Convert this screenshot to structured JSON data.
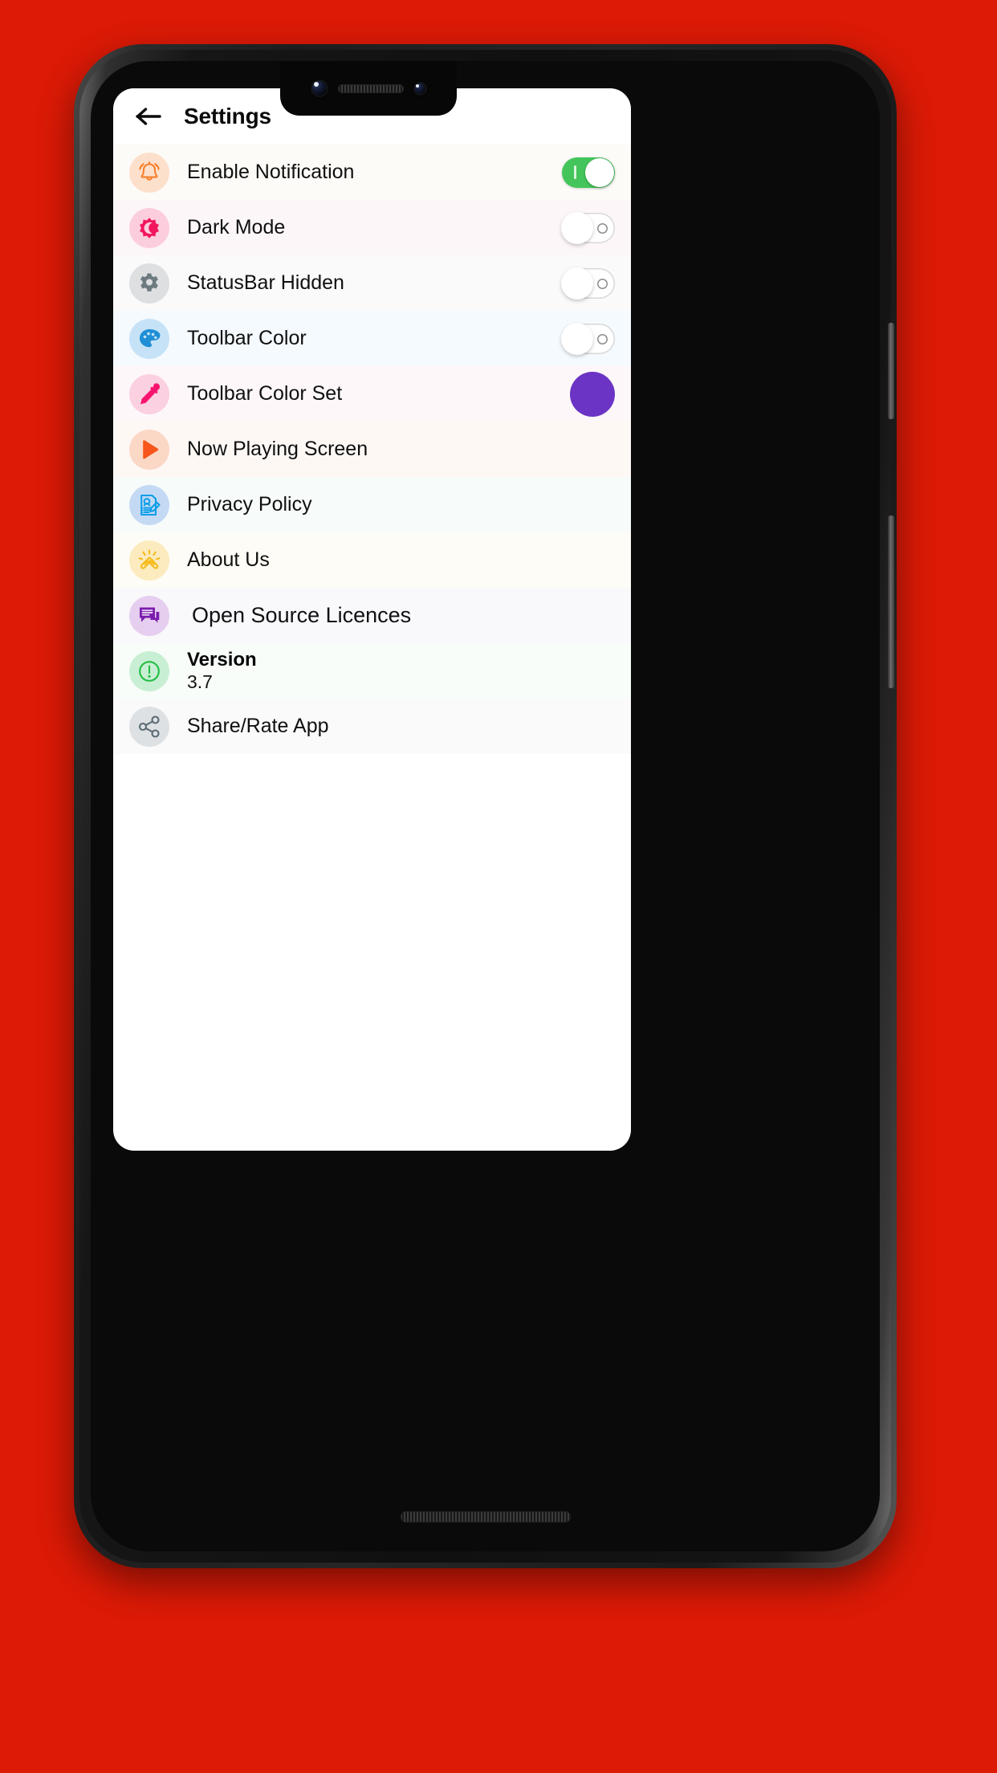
{
  "theme": {
    "background": "#DC1A06",
    "screen_background": "#FFFFFF",
    "toggle_on_color": "#44C55B",
    "toggle_off_color": "#FFFFFF",
    "swatch_color": "#6B34C4"
  },
  "header": {
    "back_icon": "arrow-left-icon",
    "title": "Settings"
  },
  "rows": [
    {
      "label": "Enable Notification",
      "icon": "bell-icon",
      "icon_color": "#F77F29",
      "icon_bg": "#FDE0CC",
      "row_bg": "#FDFBF8",
      "control": "toggle",
      "toggle_state": "on"
    },
    {
      "label": "Dark Mode",
      "icon": "dark-mode-icon",
      "icon_color": "#F2165E",
      "icon_bg": "#FCCEDD",
      "row_bg": "#FDF6F9",
      "control": "toggle",
      "toggle_state": "off"
    },
    {
      "label": "StatusBar Hidden",
      "icon": "gear-icon",
      "icon_color": "#6D7A80",
      "icon_bg": "#DEDFE1",
      "row_bg": "#FAFAFB",
      "control": "toggle",
      "toggle_state": "off"
    },
    {
      "label": "Toolbar Color",
      "icon": "palette-icon",
      "icon_color": "#1F8FD6",
      "icon_bg": "#C6E2F7",
      "row_bg": "#F4FAFE",
      "control": "toggle",
      "toggle_state": "off"
    },
    {
      "label": "Toolbar Color Set",
      "icon": "eyedropper-icon",
      "icon_color": "#F7146E",
      "icon_bg": "#FBD0E0",
      "row_bg": "#FDF7FA",
      "control": "swatch",
      "swatch_color": "#6B34C4"
    },
    {
      "label": "Now Playing Screen",
      "icon": "play-icon",
      "icon_color": "#F7551B",
      "icon_bg": "#FBD7C6",
      "row_bg": "#FEF8F5",
      "control": "none"
    },
    {
      "label": "Privacy Policy",
      "icon": "privacy-document-icon",
      "icon_color": "#0E9FE8",
      "icon_bg": "#C4D9F4",
      "row_bg": "#F7FCFA",
      "control": "none"
    },
    {
      "label": "About Us",
      "icon": "handshake-icon",
      "icon_color": "#F5BA1C",
      "icon_bg": "#FCEBBE",
      "row_bg": "#FEFCF6",
      "control": "none"
    },
    {
      "label": "Open Source Licences",
      "icon": "chat-bubbles-icon",
      "icon_color": "#7A1DAF",
      "icon_bg": "#E5CEEF",
      "row_bg": "#F9F8FB",
      "control": "none",
      "emphasis": "large"
    },
    {
      "label": "Version",
      "value": "3.7",
      "icon": "alert-circle-icon",
      "icon_color": "#22BD42",
      "icon_bg": "#C8EFD3",
      "row_bg": "#F8FDF9",
      "control": "version"
    },
    {
      "label": "Share/Rate App",
      "icon": "share-icon",
      "icon_color": "#5C6B75",
      "icon_bg": "#DDE1E4",
      "row_bg": "#FAFAFB",
      "control": "none"
    }
  ],
  "hardware": {
    "power_button": "power-button",
    "volume_button": "volume-button",
    "front_camera": "front-camera",
    "earpiece_speaker": "earpiece-speaker",
    "bottom_speaker": "bottom-speaker"
  }
}
